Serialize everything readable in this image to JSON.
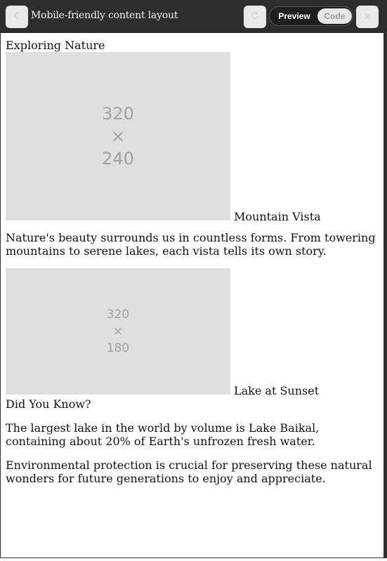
{
  "window": {
    "title": "Mobile-friendly content layout",
    "back_icon": "arrow-left-icon",
    "refresh_icon": "refresh-icon",
    "close_icon": "close-icon",
    "toggle": {
      "preview_label": "Preview",
      "code_label": "Code",
      "selected": "Preview"
    }
  },
  "article": {
    "title": "Exploring Nature",
    "image1": {
      "placeholder_w": "320",
      "placeholder_x": "×",
      "placeholder_h": "240",
      "caption": "Mountain Vista"
    },
    "paragraph1": "Nature's beauty surrounds us in countless forms. From towering mountains to serene lakes, each vista tells its own story.",
    "image2": {
      "placeholder_w": "320",
      "placeholder_x": "×",
      "placeholder_h": "180",
      "caption": "Lake at Sunset"
    },
    "subheading": "Did You Know?",
    "paragraph2": "The largest lake in the world by volume is Lake Baikal, containing about 20% of Earth's unfrozen fresh water.",
    "paragraph3": "Environmental protection is crucial for preserving these natural wonders for future generations to enjoy and appreciate."
  },
  "colors": {
    "titlebar_bg": "#2e2e2e",
    "placeholder_bg": "#dedede",
    "placeholder_text": "#a2a2a2"
  }
}
